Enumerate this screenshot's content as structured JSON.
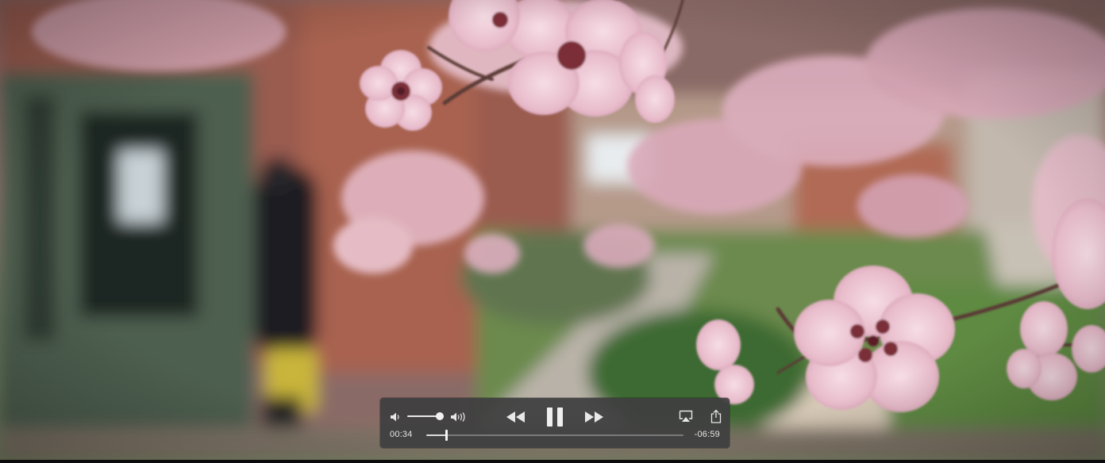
{
  "player": {
    "volume_fraction": 0.9,
    "progress_fraction": 0.077,
    "state": "playing",
    "time_elapsed": "00:34",
    "time_remaining": "-06:59"
  },
  "icons": {
    "volume_low": "speaker-low-icon",
    "volume_high": "speaker-high-icon",
    "rewind": "rewind-icon",
    "pause": "pause-icon",
    "fast_forward": "fast-forward-icon",
    "airplay": "airplay-icon",
    "share": "share-icon"
  },
  "colors": {
    "hud_background": "#3e3e40",
    "hud_foreground": "#e8e8e8"
  }
}
